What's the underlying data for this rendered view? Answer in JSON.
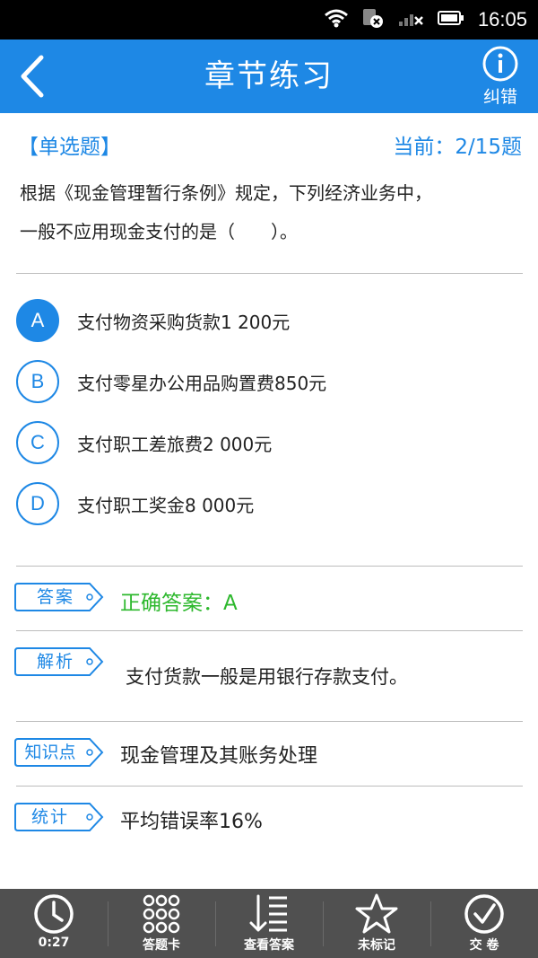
{
  "status_bar": {
    "time": "16:05"
  },
  "app_bar": {
    "title": "章节练习",
    "correction_label": "纠错"
  },
  "question": {
    "type_label": "【单选题】",
    "progress": "当前：2/15题",
    "text_line1": "根据《现金管理暂行条例》规定，下列经济业务中，",
    "text_line2": "一般不应用现金支付的是（　　）。"
  },
  "options": [
    {
      "letter": "A",
      "text": "支付物资采购货款1 200元",
      "selected": true
    },
    {
      "letter": "B",
      "text": "支付零星办公用品购置费850元",
      "selected": false
    },
    {
      "letter": "C",
      "text": "支付职工差旅费2 000元",
      "selected": false
    },
    {
      "letter": "D",
      "text": "支付职工奖金8 000元",
      "selected": false
    }
  ],
  "answer": {
    "tag": "答案",
    "text": "正确答案：A",
    "color": "#2db82d"
  },
  "analysis": {
    "tag": "解析",
    "text": "支付货款一般是用银行存款支付。"
  },
  "knowledge": {
    "tag": "知识点",
    "text": "现金管理及其账务处理"
  },
  "stats": {
    "tag": "统计",
    "text": "平均错误率16%"
  },
  "toolbar": {
    "timer_label": "0:27",
    "answer_card_label": "答题卡",
    "view_answer_label": "查看答案",
    "mark_label": "未标记",
    "submit_label": "交 卷"
  },
  "colors": {
    "accent": "#1e88e5",
    "toolbar_bg": "#505050",
    "correct": "#2db82d"
  },
  "icons": [
    "back-arrow-icon",
    "info-icon",
    "clock-icon",
    "grid-icon",
    "list-down-icon",
    "star-icon",
    "check-icon",
    "wifi-icon",
    "signal-icon",
    "battery-icon"
  ]
}
